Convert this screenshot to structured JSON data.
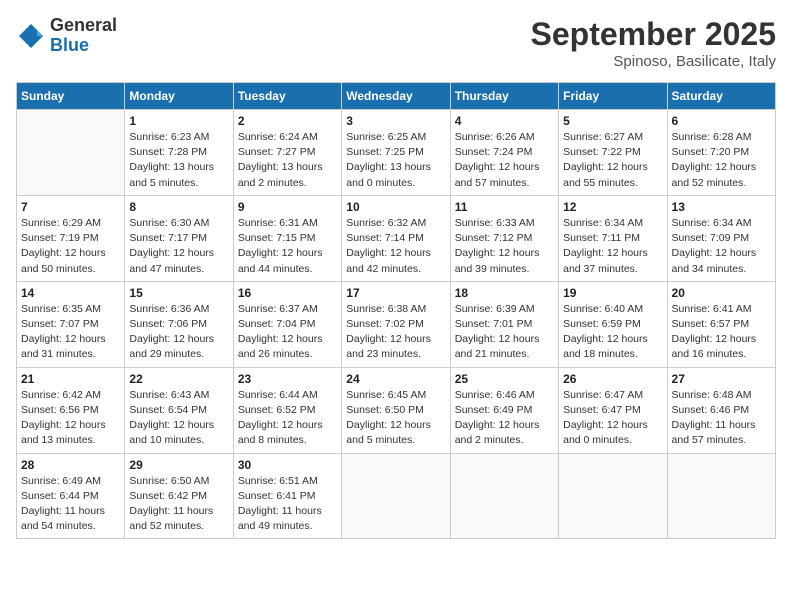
{
  "logo": {
    "general": "General",
    "blue": "Blue"
  },
  "header": {
    "month": "September 2025",
    "location": "Spinoso, Basilicate, Italy"
  },
  "weekdays": [
    "Sunday",
    "Monday",
    "Tuesday",
    "Wednesday",
    "Thursday",
    "Friday",
    "Saturday"
  ],
  "weeks": [
    [
      {
        "day": "",
        "info": ""
      },
      {
        "day": "1",
        "info": "Sunrise: 6:23 AM\nSunset: 7:28 PM\nDaylight: 13 hours\nand 5 minutes."
      },
      {
        "day": "2",
        "info": "Sunrise: 6:24 AM\nSunset: 7:27 PM\nDaylight: 13 hours\nand 2 minutes."
      },
      {
        "day": "3",
        "info": "Sunrise: 6:25 AM\nSunset: 7:25 PM\nDaylight: 13 hours\nand 0 minutes."
      },
      {
        "day": "4",
        "info": "Sunrise: 6:26 AM\nSunset: 7:24 PM\nDaylight: 12 hours\nand 57 minutes."
      },
      {
        "day": "5",
        "info": "Sunrise: 6:27 AM\nSunset: 7:22 PM\nDaylight: 12 hours\nand 55 minutes."
      },
      {
        "day": "6",
        "info": "Sunrise: 6:28 AM\nSunset: 7:20 PM\nDaylight: 12 hours\nand 52 minutes."
      }
    ],
    [
      {
        "day": "7",
        "info": "Sunrise: 6:29 AM\nSunset: 7:19 PM\nDaylight: 12 hours\nand 50 minutes."
      },
      {
        "day": "8",
        "info": "Sunrise: 6:30 AM\nSunset: 7:17 PM\nDaylight: 12 hours\nand 47 minutes."
      },
      {
        "day": "9",
        "info": "Sunrise: 6:31 AM\nSunset: 7:15 PM\nDaylight: 12 hours\nand 44 minutes."
      },
      {
        "day": "10",
        "info": "Sunrise: 6:32 AM\nSunset: 7:14 PM\nDaylight: 12 hours\nand 42 minutes."
      },
      {
        "day": "11",
        "info": "Sunrise: 6:33 AM\nSunset: 7:12 PM\nDaylight: 12 hours\nand 39 minutes."
      },
      {
        "day": "12",
        "info": "Sunrise: 6:34 AM\nSunset: 7:11 PM\nDaylight: 12 hours\nand 37 minutes."
      },
      {
        "day": "13",
        "info": "Sunrise: 6:34 AM\nSunset: 7:09 PM\nDaylight: 12 hours\nand 34 minutes."
      }
    ],
    [
      {
        "day": "14",
        "info": "Sunrise: 6:35 AM\nSunset: 7:07 PM\nDaylight: 12 hours\nand 31 minutes."
      },
      {
        "day": "15",
        "info": "Sunrise: 6:36 AM\nSunset: 7:06 PM\nDaylight: 12 hours\nand 29 minutes."
      },
      {
        "day": "16",
        "info": "Sunrise: 6:37 AM\nSunset: 7:04 PM\nDaylight: 12 hours\nand 26 minutes."
      },
      {
        "day": "17",
        "info": "Sunrise: 6:38 AM\nSunset: 7:02 PM\nDaylight: 12 hours\nand 23 minutes."
      },
      {
        "day": "18",
        "info": "Sunrise: 6:39 AM\nSunset: 7:01 PM\nDaylight: 12 hours\nand 21 minutes."
      },
      {
        "day": "19",
        "info": "Sunrise: 6:40 AM\nSunset: 6:59 PM\nDaylight: 12 hours\nand 18 minutes."
      },
      {
        "day": "20",
        "info": "Sunrise: 6:41 AM\nSunset: 6:57 PM\nDaylight: 12 hours\nand 16 minutes."
      }
    ],
    [
      {
        "day": "21",
        "info": "Sunrise: 6:42 AM\nSunset: 6:56 PM\nDaylight: 12 hours\nand 13 minutes."
      },
      {
        "day": "22",
        "info": "Sunrise: 6:43 AM\nSunset: 6:54 PM\nDaylight: 12 hours\nand 10 minutes."
      },
      {
        "day": "23",
        "info": "Sunrise: 6:44 AM\nSunset: 6:52 PM\nDaylight: 12 hours\nand 8 minutes."
      },
      {
        "day": "24",
        "info": "Sunrise: 6:45 AM\nSunset: 6:50 PM\nDaylight: 12 hours\nand 5 minutes."
      },
      {
        "day": "25",
        "info": "Sunrise: 6:46 AM\nSunset: 6:49 PM\nDaylight: 12 hours\nand 2 minutes."
      },
      {
        "day": "26",
        "info": "Sunrise: 6:47 AM\nSunset: 6:47 PM\nDaylight: 12 hours\nand 0 minutes."
      },
      {
        "day": "27",
        "info": "Sunrise: 6:48 AM\nSunset: 6:46 PM\nDaylight: 11 hours\nand 57 minutes."
      }
    ],
    [
      {
        "day": "28",
        "info": "Sunrise: 6:49 AM\nSunset: 6:44 PM\nDaylight: 11 hours\nand 54 minutes."
      },
      {
        "day": "29",
        "info": "Sunrise: 6:50 AM\nSunset: 6:42 PM\nDaylight: 11 hours\nand 52 minutes."
      },
      {
        "day": "30",
        "info": "Sunrise: 6:51 AM\nSunset: 6:41 PM\nDaylight: 11 hours\nand 49 minutes."
      },
      {
        "day": "",
        "info": ""
      },
      {
        "day": "",
        "info": ""
      },
      {
        "day": "",
        "info": ""
      },
      {
        "day": "",
        "info": ""
      }
    ]
  ]
}
